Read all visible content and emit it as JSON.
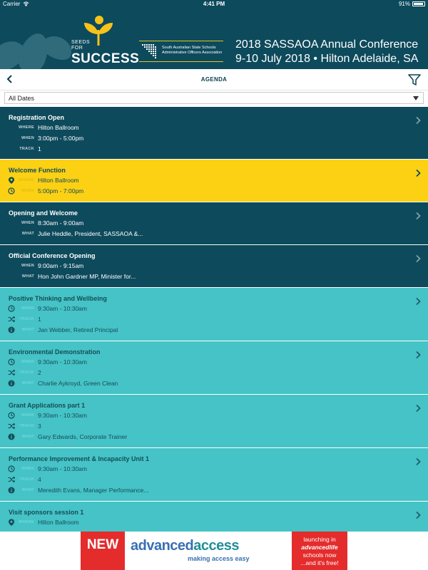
{
  "status_bar": {
    "carrier": "Carrier",
    "time": "4:41 PM",
    "battery": "91%"
  },
  "banner": {
    "logo_seeds": "SEEDS",
    "logo_for": "FOR",
    "logo_success": "SUCCESS",
    "assoc_line1": "South Australian State Schools",
    "assoc_line2": "Administrative Officers Association",
    "conference_line1": "2018 SASSAOA Annual Conference",
    "conference_line2": "9-10 July 2018 • Hilton Adelaide, SA",
    "colors": {
      "background": "#0d4a5c",
      "accent": "#e7c51d"
    }
  },
  "nav": {
    "title": "AGENDA",
    "back_icon": "chevron-left-icon",
    "filter_icon": "filter-icon"
  },
  "date_filter": {
    "selected": "All Dates"
  },
  "labels": {
    "where": "WHERE",
    "when": "WHEN",
    "track": "TRACK",
    "what": "WHAT"
  },
  "agenda": [
    {
      "title": "Registration Open",
      "style": "navy",
      "rows": [
        {
          "label": "WHERE",
          "value": "Hilton Ballroom",
          "icon": ""
        },
        {
          "label": "WHEN",
          "value": "3:00pm - 5:00pm",
          "icon": ""
        },
        {
          "label": "TRACK",
          "value": "1",
          "icon": ""
        }
      ]
    },
    {
      "title": "Welcome Function",
      "style": "yellow",
      "rows": [
        {
          "label": "WHERE",
          "value": "Hilton Ballroom",
          "icon": "map-pin-icon"
        },
        {
          "label": "WHEN",
          "value": "5:00pm - 7:00pm",
          "icon": "clock-icon"
        }
      ]
    },
    {
      "title": "Opening and Welcome",
      "style": "navy",
      "rows": [
        {
          "label": "WHEN",
          "value": "8:30am - 9:00am",
          "icon": ""
        },
        {
          "label": "WHAT",
          "value": "Julie Heddle, President, SASSAOA &...",
          "icon": ""
        }
      ]
    },
    {
      "title": "Official Conference Opening",
      "style": "navy",
      "rows": [
        {
          "label": "WHEN",
          "value": "9:00am - 9:15am",
          "icon": ""
        },
        {
          "label": "WHAT",
          "value": "Hon John Gardner MP, Minister for...",
          "icon": ""
        }
      ]
    },
    {
      "title": "Positive Thinking and Wellbeing",
      "style": "teal",
      "rows": [
        {
          "label": "WHEN",
          "value": "9:30am - 10:30am",
          "icon": "clock-icon"
        },
        {
          "label": "TRACK",
          "value": "1",
          "icon": "shuffle-icon"
        },
        {
          "label": "WHAT",
          "value": "Jan Webber, Retired Principal",
          "icon": "info-icon"
        }
      ]
    },
    {
      "title": "Environmental Demonstration",
      "style": "teal",
      "rows": [
        {
          "label": "WHEN",
          "value": "9:30am - 10:30am",
          "icon": "clock-icon"
        },
        {
          "label": "TRACK",
          "value": "2",
          "icon": "shuffle-icon"
        },
        {
          "label": "WHAT",
          "value": "Charlie Aykroyd, Green Clean",
          "icon": "info-icon"
        }
      ]
    },
    {
      "title": "Grant Applications part 1",
      "style": "teal",
      "rows": [
        {
          "label": "WHEN",
          "value": "9:30am - 10:30am",
          "icon": "clock-icon"
        },
        {
          "label": "TRACK",
          "value": "3",
          "icon": "shuffle-icon"
        },
        {
          "label": "WHAT",
          "value": "Gary Edwards, Corporate Trainer",
          "icon": "info-icon"
        }
      ]
    },
    {
      "title": "Performance Improvement & Incapacity Unit 1",
      "style": "teal",
      "rows": [
        {
          "label": "WHEN",
          "value": "9:30am - 10:30am",
          "icon": "clock-icon"
        },
        {
          "label": "TRACK",
          "value": "4",
          "icon": "shuffle-icon"
        },
        {
          "label": "WHAT",
          "value": "Meredith Evans, Manager Performance...",
          "icon": "info-icon"
        }
      ]
    },
    {
      "title": "Visit sponsors session 1",
      "style": "teal",
      "rows": [
        {
          "label": "WHERE",
          "value": "Hilton Ballroom",
          "icon": "map-pin-icon"
        }
      ]
    }
  ],
  "ad": {
    "new": "NEW",
    "brand_part1": "advanced",
    "brand_part2": "access",
    "tagline": "making access easy",
    "right_line1": "launching in",
    "right_line2": "advancedlife",
    "right_line3": "schools now",
    "right_line4": "...and it's free!"
  }
}
